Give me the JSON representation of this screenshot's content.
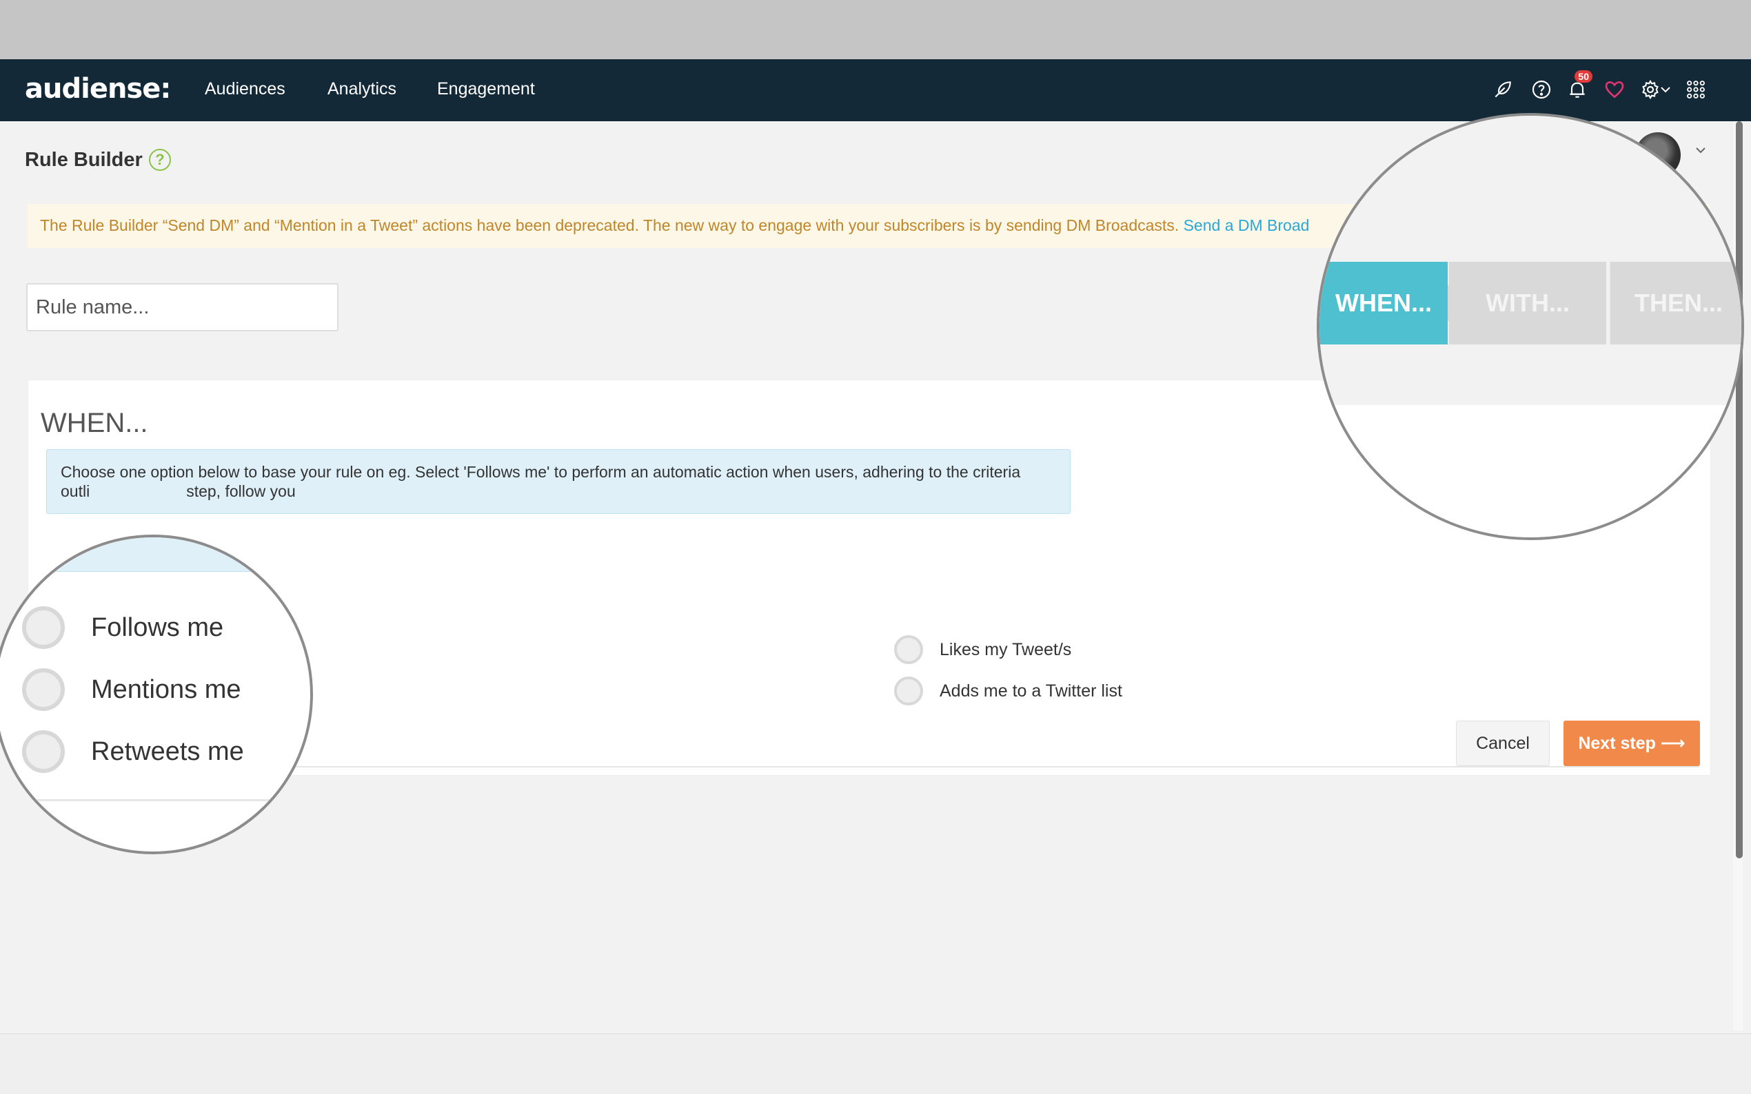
{
  "app": {
    "logo": "audiense:"
  },
  "nav": {
    "links": [
      "Audiences",
      "Analytics",
      "Engagement"
    ],
    "notifications_count": "50",
    "icons": [
      "feather-icon",
      "help-icon",
      "bell-icon",
      "heart-icon",
      "gear-icon",
      "chevron-down-icon",
      "apps-grid-icon"
    ]
  },
  "page": {
    "title": "Rule Builder",
    "help_glyph": "?"
  },
  "alert": {
    "text": "The Rule Builder “Send DM” and “Mention in a Tweet” actions have been deprecated. The new way to engage with your subscribers is by sending DM Broadcasts.",
    "link": "Send a DM Broad"
  },
  "form": {
    "rule_name_placeholder": "Rule name..."
  },
  "steps": [
    "WHEN...",
    "WITH...",
    "THEN..."
  ],
  "when": {
    "heading": "WHEN...",
    "info_line1": "Choose one option below to base your rule on eg. Select 'Follows me' to perform an automatic action when users, adhering to the criteria",
    "info_line2": "outli",
    "info_line2_end": "step, follow you",
    "options_left": [
      "Follows me",
      "Mentions me",
      "Retweets me"
    ],
    "options_right": [
      "Likes my Tweet/s",
      "Adds me to a Twitter list"
    ]
  },
  "buttons": {
    "cancel": "Cancel",
    "next": "Next step ⟶"
  },
  "colors": {
    "navbar": "#132937",
    "accent_teal": "#4ec0cf",
    "next_orange": "#f0894a",
    "alert_text": "#c0862a",
    "link_blue": "#29a8d8"
  }
}
